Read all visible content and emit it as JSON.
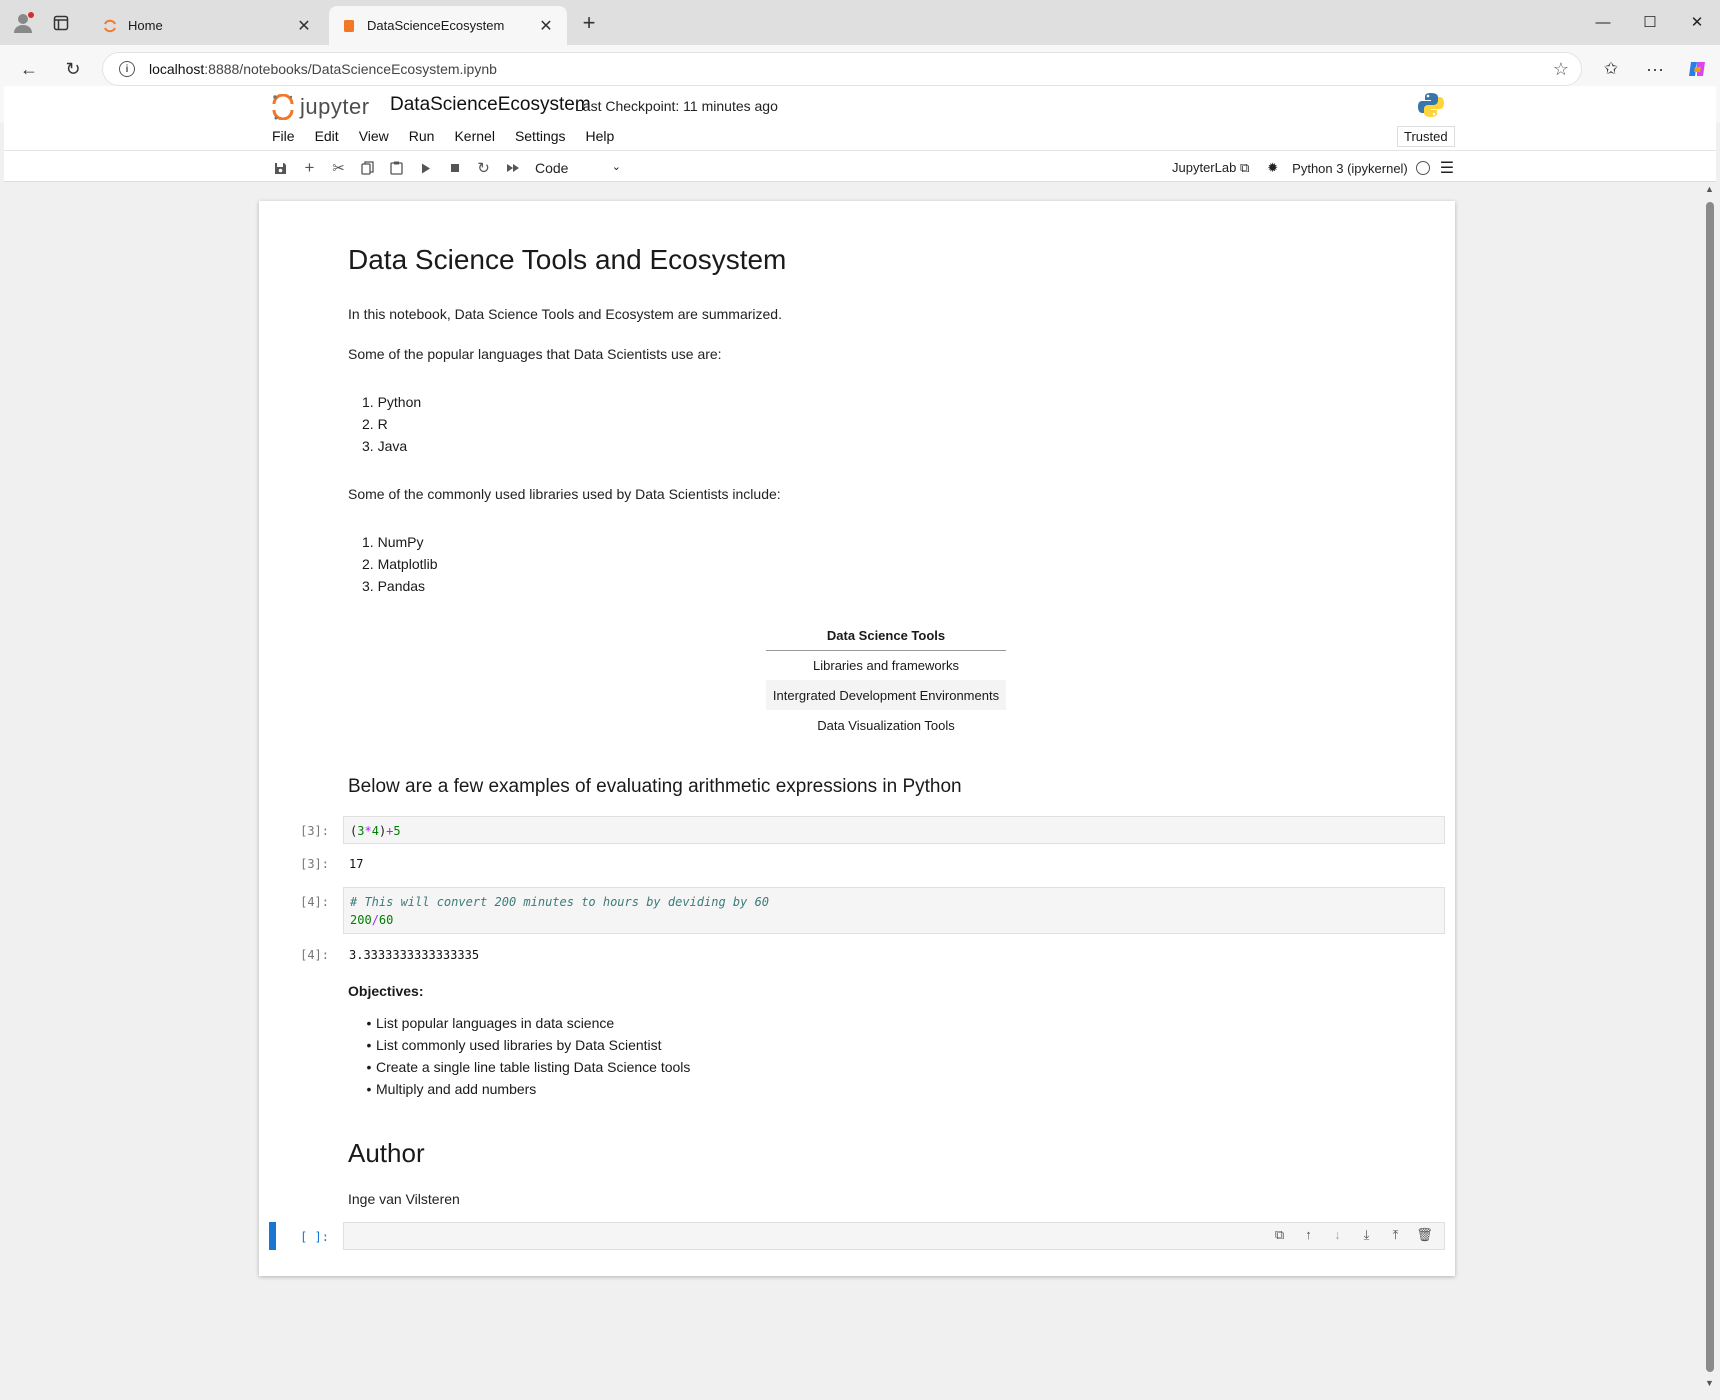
{
  "browser": {
    "tabs": [
      {
        "label": "Home",
        "active": false
      },
      {
        "label": "DataScienceEcosystem",
        "active": true
      }
    ],
    "url": {
      "host": "localhost",
      "rest": ":8888/notebooks/DataScienceEcosystem.ipynb"
    },
    "buttons": {
      "back": "←",
      "reload": "↻",
      "new_tab": "+",
      "minimize": "—",
      "maximize": "☐",
      "close": "✕",
      "more": "···"
    }
  },
  "jupyter": {
    "logo_text": "jupyter",
    "notebook_title": "DataScienceEcosystem",
    "checkpoint": "Last Checkpoint: 11 minutes ago",
    "menu": [
      "File",
      "Edit",
      "View",
      "Run",
      "Kernel",
      "Settings",
      "Help"
    ],
    "trusted": "Trusted",
    "cell_type": "Code",
    "jupyterlab_link": "JupyterLab",
    "kernel_name": "Python 3 (ipykernel)"
  },
  "notebook": {
    "title": "Data Science Tools and Ecosystem",
    "intro": "In this notebook, Data Science Tools and Ecosystem are summarized.",
    "languages_intro": "Some of the popular languages that Data Scientists use are:",
    "languages": [
      "Python",
      "R",
      "Java"
    ],
    "libraries_intro": "Some of the commonly used libraries used by Data Scientists include:",
    "libraries": [
      "NumPy",
      "Matplotlib",
      "Pandas"
    ],
    "table": {
      "header": "Data Science Tools",
      "rows": [
        "Libraries and frameworks",
        "Intergrated Development Environments",
        "Data Visualization Tools"
      ]
    },
    "arith_heading": "Below are a few examples of evaluating arithmetic expressions in Python",
    "cell1": {
      "prompt_in": "[3]:",
      "prompt_out": "[3]:",
      "output": "17"
    },
    "cell2": {
      "prompt_in": "[4]:",
      "prompt_out": "[4]:",
      "comment": "# This will convert 200 minutes to hours by deviding by 60",
      "output": "3.3333333333333335"
    },
    "objectives_label": "Objectives:",
    "objectives": [
      "List popular languages in data science",
      "List commonly used libraries by Data Scientist",
      "Create a single line table listing Data Science tools",
      "Multiply and add numbers"
    ],
    "author_heading": "Author",
    "author_name": "Inge van Vilsteren",
    "empty_prompt": "[ ]:"
  },
  "colors": {
    "accent": "#1976d2",
    "jupyter_orange": "#f37726"
  }
}
